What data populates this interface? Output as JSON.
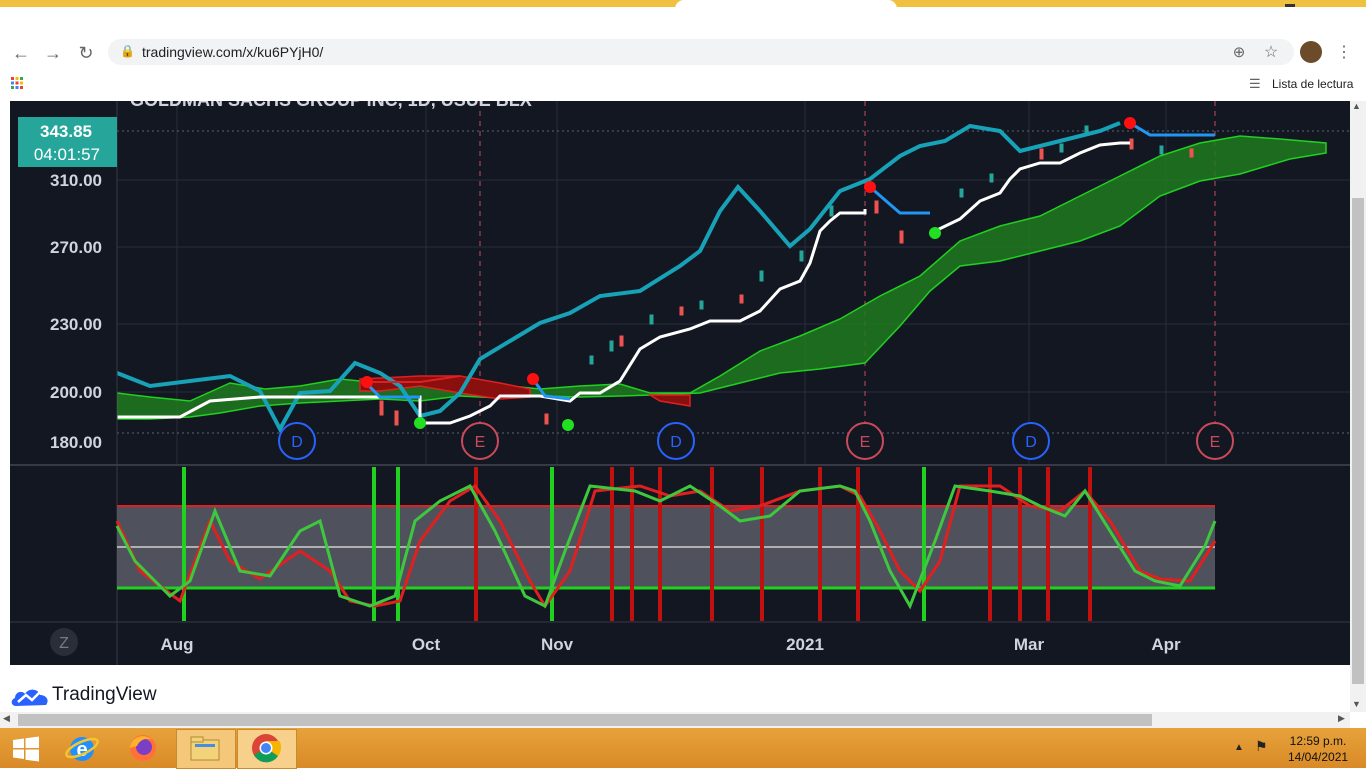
{
  "browser": {
    "url": "tradingview.com/x/ku6PYjH0/",
    "reading_list": "Lista de lectura"
  },
  "chart": {
    "title_partial": "GOLDMAN SACHS GROUP INC, 1D, USUE BLX",
    "price_badge": "343.85",
    "countdown_badge": "04:01:57",
    "price_axis": [
      "310.00",
      "270.00",
      "230.00",
      "200.00",
      "180.00"
    ],
    "time_axis": [
      "Aug",
      "Oct",
      "Nov",
      "2021",
      "Mar",
      "Apr"
    ],
    "zoom_label": "Z",
    "event_markers": [
      "D",
      "E",
      "D",
      "E",
      "D",
      "E"
    ]
  },
  "brand": {
    "name": "TradingView"
  },
  "taskbar": {
    "time": "12:59 p.m.",
    "date": "14/04/2021"
  },
  "colors": {
    "background": "#131722",
    "badge": "#26a69a",
    "cloud_green": "#1a7a1a",
    "cloud_red": "#a01010",
    "cyan_line": "#17a2b8",
    "white_line": "#ffffff",
    "blue_line": "#2196f3"
  }
}
